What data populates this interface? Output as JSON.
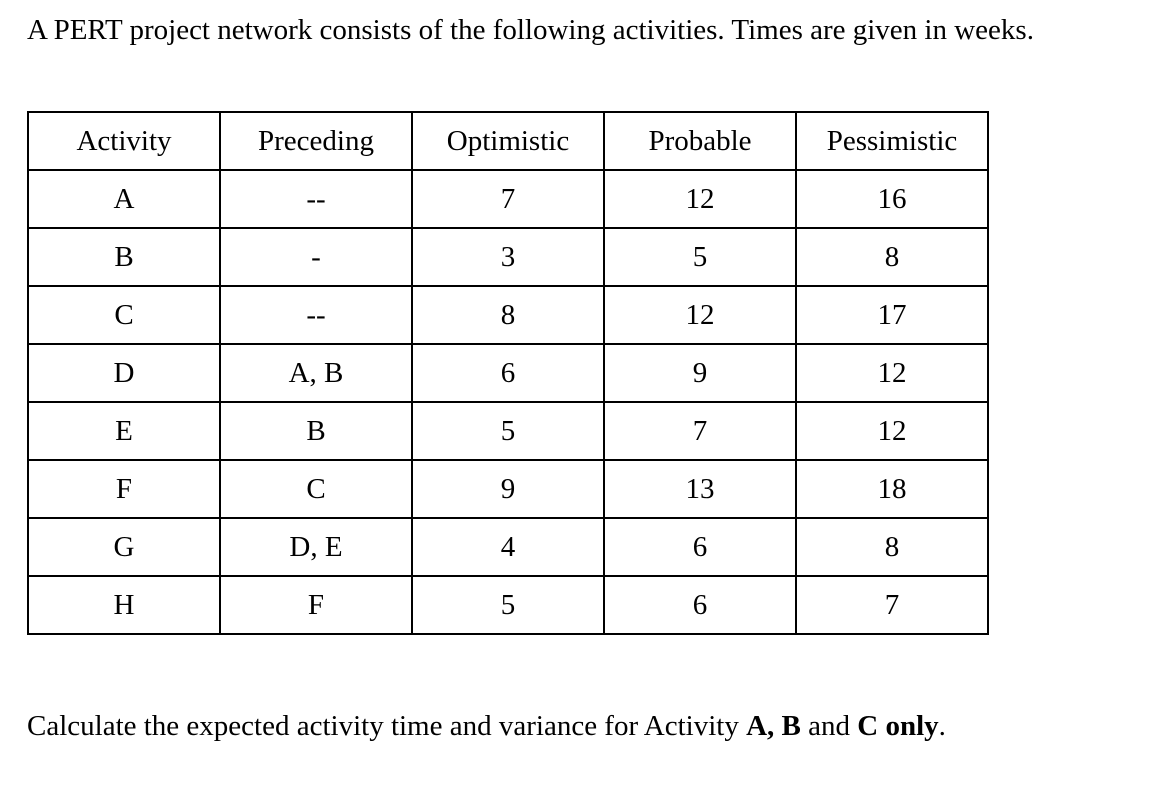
{
  "intro": "A PERT project network consists of the following activities. Times are given in weeks.",
  "table": {
    "headers": [
      "Activity",
      "Preceding",
      "Optimistic",
      "Probable",
      "Pessimistic"
    ],
    "rows": [
      [
        "A",
        "--",
        "7",
        "12",
        "16"
      ],
      [
        "B",
        "-",
        "3",
        "5",
        "8"
      ],
      [
        "C",
        "--",
        "8",
        "12",
        "17"
      ],
      [
        "D",
        "A, B",
        "6",
        "9",
        "12"
      ],
      [
        "E",
        "B",
        "5",
        "7",
        "12"
      ],
      [
        "F",
        "C",
        "9",
        "13",
        "18"
      ],
      [
        "G",
        "D, E",
        "4",
        "6",
        "8"
      ],
      [
        "H",
        "F",
        "5",
        "6",
        "7"
      ]
    ]
  },
  "question": {
    "prefix": "Calculate the expected activity time and variance for Activity ",
    "bold1": "A, B",
    "mid": " and ",
    "bold2": "C only",
    "suffix": "."
  }
}
